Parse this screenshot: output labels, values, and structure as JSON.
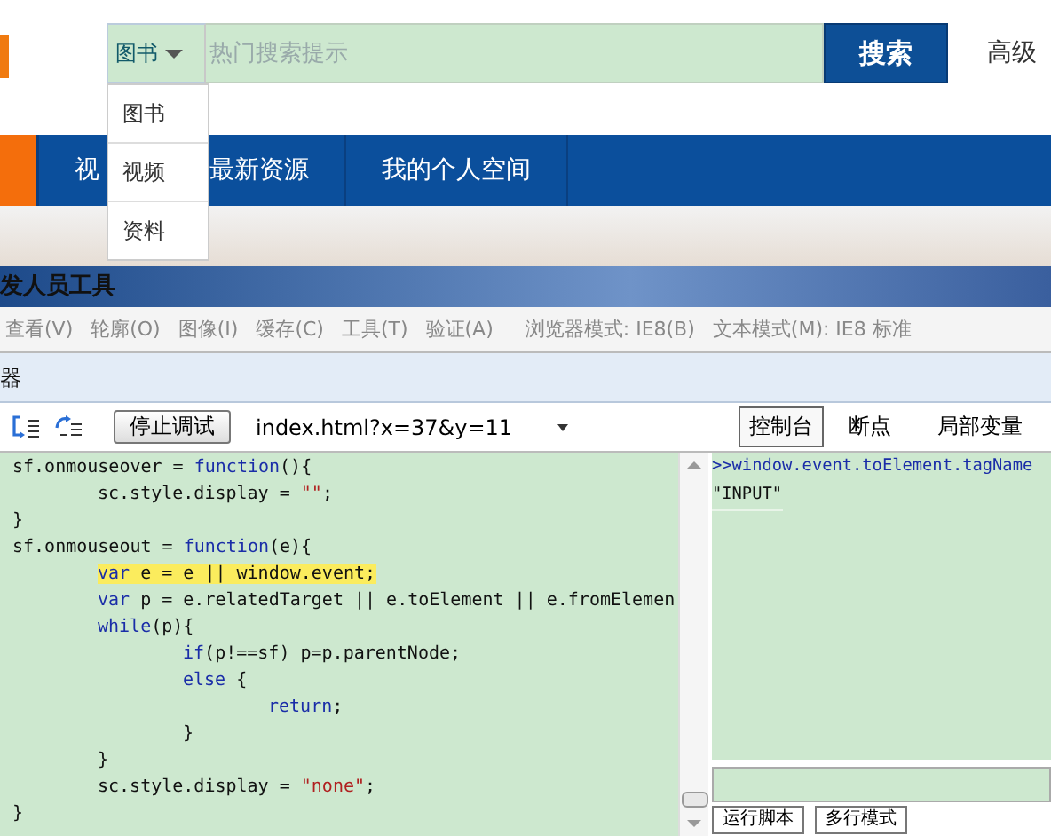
{
  "search": {
    "category": "图书",
    "placeholder": "热门搜索提示",
    "button": "搜索",
    "advanced": "高级"
  },
  "category_menu": {
    "items": [
      {
        "label": "图书"
      },
      {
        "label": "视频"
      },
      {
        "label": "资料"
      }
    ]
  },
  "nav": {
    "items": [
      {
        "label": "视"
      },
      {
        "label": "最新资源"
      },
      {
        "label": "我的个人空间"
      }
    ]
  },
  "devtools": {
    "title": "发人员工具",
    "menu": [
      "查看(V)",
      "轮廓(O)",
      "图像(I)",
      "缓存(C)",
      "工具(T)",
      "验证(A)",
      "浏览器模式: IE8(B)",
      "文本模式(M): IE8 标准"
    ],
    "tab": "器",
    "toolbar": {
      "stop_button": "停止调试",
      "script_select": "index.html?x=37&y=11"
    },
    "side_tabs": [
      {
        "label": "控制台",
        "selected": true
      },
      {
        "label": "断点",
        "selected": false
      },
      {
        "label": "局部变量",
        "selected": false
      }
    ],
    "code": [
      {
        "highlighted": false,
        "tokens": [
          {
            "kind": "plain",
            "text": "sf.onmouseover = "
          },
          {
            "kind": "keyword",
            "text": "function"
          },
          {
            "kind": "plain",
            "text": "(){"
          }
        ],
        "children": [
          {
            "highlighted": false,
            "tokens": [
              {
                "kind": "plain",
                "text": "sc.style.display = "
              },
              {
                "kind": "string",
                "text": "\"\""
              },
              {
                "kind": "plain",
                "text": ";"
              }
            ]
          }
        ]
      },
      {
        "highlighted": false,
        "tokens": [
          {
            "kind": "plain",
            "text": "}"
          }
        ]
      },
      {
        "highlighted": false,
        "tokens": [
          {
            "kind": "plain",
            "text": "sf.onmouseout = "
          },
          {
            "kind": "keyword",
            "text": "function"
          },
          {
            "kind": "plain",
            "text": "(e){"
          }
        ],
        "children": [
          {
            "highlighted": true,
            "tokens": [
              {
                "kind": "keyword",
                "text": "var"
              },
              {
                "kind": "plain",
                "text": " e = e || window.event;"
              }
            ]
          },
          {
            "highlighted": false,
            "tokens": [
              {
                "kind": "keyword",
                "text": "var"
              },
              {
                "kind": "plain",
                "text": " p = e.relatedTarget || e.toElement || e.fromElemen"
              }
            ]
          },
          {
            "highlighted": false,
            "tokens": [
              {
                "kind": "keyword",
                "text": "while"
              },
              {
                "kind": "plain",
                "text": "(p){"
              }
            ],
            "children": [
              {
                "highlighted": false,
                "tokens": [
                  {
                    "kind": "keyword",
                    "text": "if"
                  },
                  {
                    "kind": "plain",
                    "text": "(p!==sf) p=p.parentNode;"
                  }
                ]
              },
              {
                "highlighted": false,
                "tokens": [
                  {
                    "kind": "keyword",
                    "text": "else"
                  },
                  {
                    "kind": "plain",
                    "text": " {"
                  }
                ],
                "children": [
                  {
                    "highlighted": false,
                    "tokens": [
                      {
                        "kind": "keyword",
                        "text": "return"
                      },
                      {
                        "kind": "plain",
                        "text": ";"
                      }
                    ]
                  }
                ]
              },
              {
                "highlighted": false,
                "tokens": [
                  {
                    "kind": "plain",
                    "text": "}"
                  }
                ]
              }
            ]
          },
          {
            "highlighted": false,
            "tokens": [
              {
                "kind": "plain",
                "text": "}"
              }
            ]
          },
          {
            "highlighted": false,
            "tokens": [
              {
                "kind": "plain",
                "text": "sc.style.display = "
              },
              {
                "kind": "string",
                "text": "\"none\""
              },
              {
                "kind": "plain",
                "text": ";"
              }
            ]
          }
        ]
      },
      {
        "highlighted": false,
        "tokens": [
          {
            "kind": "plain",
            "text": "}"
          }
        ]
      }
    ],
    "console": [
      {
        "kind": "input",
        "text": ">>window.event.toElement.tagName"
      },
      {
        "kind": "output",
        "text": "\"INPUT\""
      }
    ],
    "console_buttons": [
      "运行脚本",
      "多行模式"
    ]
  }
}
